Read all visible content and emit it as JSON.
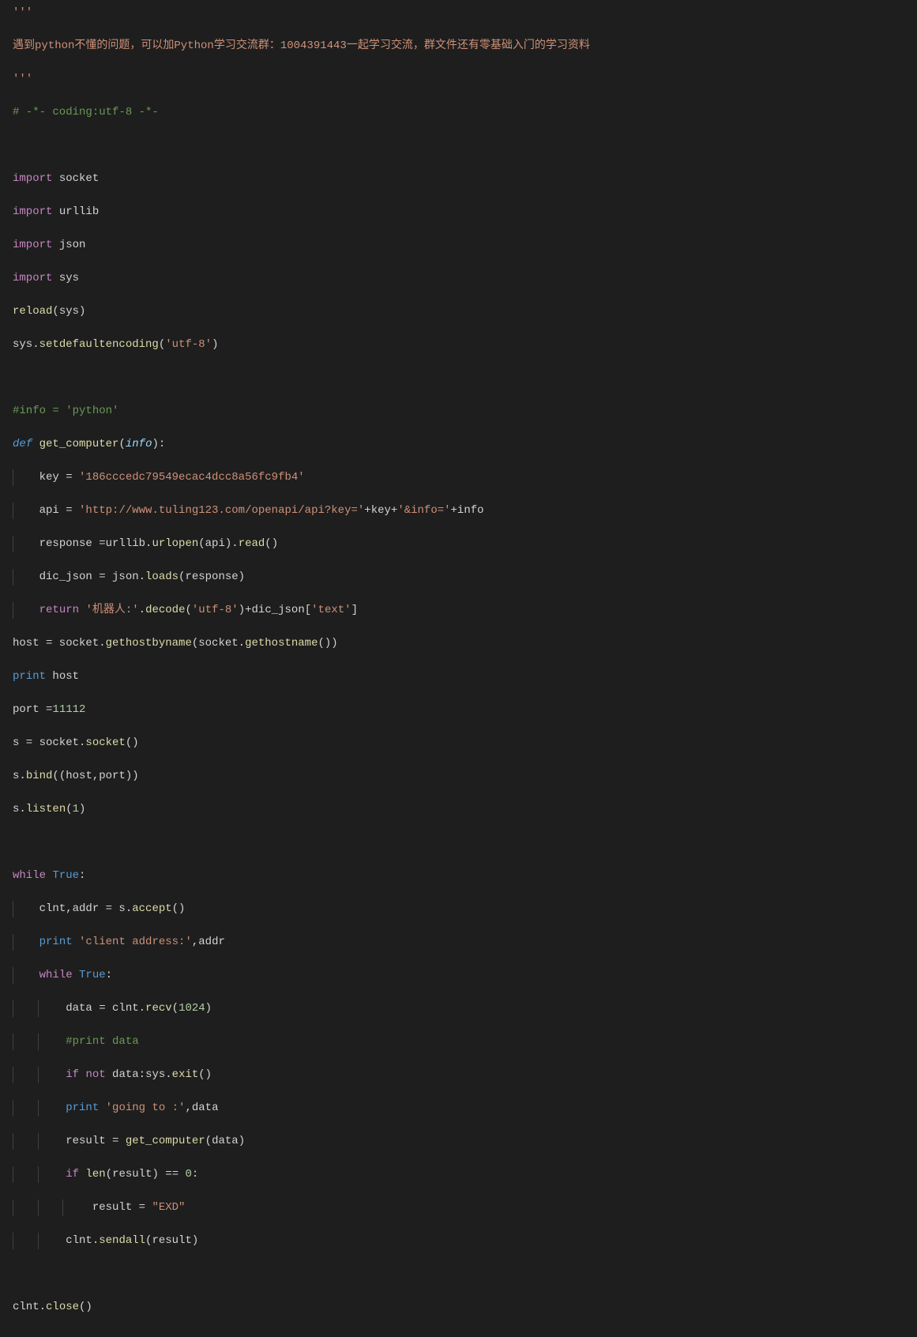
{
  "code": {
    "lines": [
      {
        "indent": 0,
        "tokens": [
          {
            "cls": "tk-string",
            "t": "'''"
          }
        ]
      },
      {
        "indent": 0,
        "tokens": [
          {
            "cls": "tk-string",
            "t": "遇到python不懂的问题，可以加Python学习交流群：1004391443一起学习交流，群文件还有零基础入门的学习资料"
          }
        ]
      },
      {
        "indent": 0,
        "tokens": [
          {
            "cls": "tk-string",
            "t": "'''"
          }
        ]
      },
      {
        "indent": 0,
        "tokens": [
          {
            "cls": "tk-comment",
            "t": "# -*- coding:utf-8 -*-"
          }
        ]
      },
      {
        "indent": 0,
        "tokens": []
      },
      {
        "indent": 0,
        "tokens": [
          {
            "cls": "tk-keyword",
            "t": "import"
          },
          {
            "cls": "tk-default",
            "t": " socket"
          }
        ]
      },
      {
        "indent": 0,
        "tokens": [
          {
            "cls": "tk-keyword",
            "t": "import"
          },
          {
            "cls": "tk-default",
            "t": " urllib"
          }
        ]
      },
      {
        "indent": 0,
        "tokens": [
          {
            "cls": "tk-keyword",
            "t": "import"
          },
          {
            "cls": "tk-default",
            "t": " json"
          }
        ]
      },
      {
        "indent": 0,
        "tokens": [
          {
            "cls": "tk-keyword",
            "t": "import"
          },
          {
            "cls": "tk-default",
            "t": " sys"
          }
        ]
      },
      {
        "indent": 0,
        "tokens": [
          {
            "cls": "tk-funccall",
            "t": "reload"
          },
          {
            "cls": "tk-punct",
            "t": "("
          },
          {
            "cls": "tk-default",
            "t": "sys"
          },
          {
            "cls": "tk-punct",
            "t": ")"
          }
        ]
      },
      {
        "indent": 0,
        "tokens": [
          {
            "cls": "tk-default",
            "t": "sys."
          },
          {
            "cls": "tk-funccall",
            "t": "setdefaultencoding"
          },
          {
            "cls": "tk-punct",
            "t": "("
          },
          {
            "cls": "tk-string",
            "t": "'utf-8'"
          },
          {
            "cls": "tk-punct",
            "t": ")"
          }
        ]
      },
      {
        "indent": 0,
        "tokens": []
      },
      {
        "indent": 0,
        "tokens": [
          {
            "cls": "tk-comment",
            "t": "#info = 'python'"
          }
        ]
      },
      {
        "indent": 0,
        "tokens": [
          {
            "cls": "tk-defkw",
            "t": "def"
          },
          {
            "cls": "tk-default",
            "t": " "
          },
          {
            "cls": "tk-funcname",
            "t": "get_computer"
          },
          {
            "cls": "tk-punct",
            "t": "("
          },
          {
            "cls": "tk-param",
            "t": "info"
          },
          {
            "cls": "tk-punct",
            "t": "):"
          }
        ]
      },
      {
        "indent": 1,
        "tokens": [
          {
            "cls": "tk-default",
            "t": "key = "
          },
          {
            "cls": "tk-string",
            "t": "'186cccedc79549ecac4dcc8a56fc9fb4'"
          }
        ]
      },
      {
        "indent": 1,
        "tokens": [
          {
            "cls": "tk-default",
            "t": "api = "
          },
          {
            "cls": "tk-string",
            "t": "'http://www.tuling123.com/openapi/api?key='"
          },
          {
            "cls": "tk-default",
            "t": "+key+"
          },
          {
            "cls": "tk-string",
            "t": "'&info='"
          },
          {
            "cls": "tk-default",
            "t": "+info"
          }
        ]
      },
      {
        "indent": 1,
        "tokens": [
          {
            "cls": "tk-default",
            "t": "response =urllib."
          },
          {
            "cls": "tk-funccall",
            "t": "urlopen"
          },
          {
            "cls": "tk-punct",
            "t": "("
          },
          {
            "cls": "tk-default",
            "t": "api"
          },
          {
            "cls": "tk-punct",
            "t": ")."
          },
          {
            "cls": "tk-funccall",
            "t": "read"
          },
          {
            "cls": "tk-punct",
            "t": "()"
          }
        ]
      },
      {
        "indent": 1,
        "tokens": [
          {
            "cls": "tk-default",
            "t": "dic_json = json."
          },
          {
            "cls": "tk-funccall",
            "t": "loads"
          },
          {
            "cls": "tk-punct",
            "t": "("
          },
          {
            "cls": "tk-default",
            "t": "response"
          },
          {
            "cls": "tk-punct",
            "t": ")"
          }
        ]
      },
      {
        "indent": 1,
        "tokens": [
          {
            "cls": "tk-keyword",
            "t": "return"
          },
          {
            "cls": "tk-default",
            "t": " "
          },
          {
            "cls": "tk-string",
            "t": "'机器人:'"
          },
          {
            "cls": "tk-punct",
            "t": "."
          },
          {
            "cls": "tk-funccall",
            "t": "decode"
          },
          {
            "cls": "tk-punct",
            "t": "("
          },
          {
            "cls": "tk-string",
            "t": "'utf-8'"
          },
          {
            "cls": "tk-punct",
            "t": ")+"
          },
          {
            "cls": "tk-default",
            "t": "dic_json["
          },
          {
            "cls": "tk-string",
            "t": "'text'"
          },
          {
            "cls": "tk-default",
            "t": "]"
          }
        ]
      },
      {
        "indent": 0,
        "tokens": [
          {
            "cls": "tk-default",
            "t": "host = socket."
          },
          {
            "cls": "tk-funccall",
            "t": "gethostbyname"
          },
          {
            "cls": "tk-punct",
            "t": "("
          },
          {
            "cls": "tk-default",
            "t": "socket."
          },
          {
            "cls": "tk-funccall",
            "t": "gethostname"
          },
          {
            "cls": "tk-punct",
            "t": "())"
          }
        ]
      },
      {
        "indent": 0,
        "tokens": [
          {
            "cls": "tk-const",
            "t": "print"
          },
          {
            "cls": "tk-default",
            "t": " host"
          }
        ]
      },
      {
        "indent": 0,
        "tokens": [
          {
            "cls": "tk-default",
            "t": "port ="
          },
          {
            "cls": "tk-number",
            "t": "11112"
          }
        ]
      },
      {
        "indent": 0,
        "tokens": [
          {
            "cls": "tk-default",
            "t": "s = socket."
          },
          {
            "cls": "tk-funccall",
            "t": "socket"
          },
          {
            "cls": "tk-punct",
            "t": "()"
          }
        ]
      },
      {
        "indent": 0,
        "tokens": [
          {
            "cls": "tk-default",
            "t": "s."
          },
          {
            "cls": "tk-funccall",
            "t": "bind"
          },
          {
            "cls": "tk-punct",
            "t": "(("
          },
          {
            "cls": "tk-default",
            "t": "host,port"
          },
          {
            "cls": "tk-punct",
            "t": "))"
          }
        ]
      },
      {
        "indent": 0,
        "tokens": [
          {
            "cls": "tk-default",
            "t": "s."
          },
          {
            "cls": "tk-funccall",
            "t": "listen"
          },
          {
            "cls": "tk-punct",
            "t": "("
          },
          {
            "cls": "tk-number",
            "t": "1"
          },
          {
            "cls": "tk-punct",
            "t": ")"
          }
        ]
      },
      {
        "indent": 0,
        "tokens": []
      },
      {
        "indent": 0,
        "tokens": [
          {
            "cls": "tk-keyword",
            "t": "while"
          },
          {
            "cls": "tk-default",
            "t": " "
          },
          {
            "cls": "tk-const",
            "t": "True"
          },
          {
            "cls": "tk-punct",
            "t": ":"
          }
        ]
      },
      {
        "indent": 1,
        "tokens": [
          {
            "cls": "tk-default",
            "t": "clnt,addr = s."
          },
          {
            "cls": "tk-funccall",
            "t": "accept"
          },
          {
            "cls": "tk-punct",
            "t": "()"
          }
        ]
      },
      {
        "indent": 1,
        "tokens": [
          {
            "cls": "tk-const",
            "t": "print"
          },
          {
            "cls": "tk-default",
            "t": " "
          },
          {
            "cls": "tk-string",
            "t": "'client address:'"
          },
          {
            "cls": "tk-default",
            "t": ",addr"
          }
        ]
      },
      {
        "indent": 1,
        "tokens": [
          {
            "cls": "tk-keyword",
            "t": "while"
          },
          {
            "cls": "tk-default",
            "t": " "
          },
          {
            "cls": "tk-const",
            "t": "True"
          },
          {
            "cls": "tk-punct",
            "t": ":"
          }
        ]
      },
      {
        "indent": 2,
        "tokens": [
          {
            "cls": "tk-default",
            "t": "data = clnt."
          },
          {
            "cls": "tk-funccall",
            "t": "recv"
          },
          {
            "cls": "tk-punct",
            "t": "("
          },
          {
            "cls": "tk-number",
            "t": "1024"
          },
          {
            "cls": "tk-punct",
            "t": ")"
          }
        ]
      },
      {
        "indent": 2,
        "tokens": [
          {
            "cls": "tk-comment",
            "t": "#print data"
          }
        ]
      },
      {
        "indent": 2,
        "tokens": [
          {
            "cls": "tk-keyword",
            "t": "if"
          },
          {
            "cls": "tk-default",
            "t": " "
          },
          {
            "cls": "tk-keyword",
            "t": "not"
          },
          {
            "cls": "tk-default",
            "t": " data:sys."
          },
          {
            "cls": "tk-funccall",
            "t": "exit"
          },
          {
            "cls": "tk-punct",
            "t": "()"
          }
        ]
      },
      {
        "indent": 2,
        "tokens": [
          {
            "cls": "tk-const",
            "t": "print"
          },
          {
            "cls": "tk-default",
            "t": " "
          },
          {
            "cls": "tk-string",
            "t": "'going to :'"
          },
          {
            "cls": "tk-default",
            "t": ",data"
          }
        ]
      },
      {
        "indent": 2,
        "tokens": [
          {
            "cls": "tk-default",
            "t": "result = "
          },
          {
            "cls": "tk-funccall",
            "t": "get_computer"
          },
          {
            "cls": "tk-punct",
            "t": "("
          },
          {
            "cls": "tk-default",
            "t": "data"
          },
          {
            "cls": "tk-punct",
            "t": ")"
          }
        ]
      },
      {
        "indent": 2,
        "tokens": [
          {
            "cls": "tk-keyword",
            "t": "if"
          },
          {
            "cls": "tk-default",
            "t": " "
          },
          {
            "cls": "tk-funccall",
            "t": "len"
          },
          {
            "cls": "tk-punct",
            "t": "("
          },
          {
            "cls": "tk-default",
            "t": "result"
          },
          {
            "cls": "tk-punct",
            "t": ") == "
          },
          {
            "cls": "tk-number",
            "t": "0"
          },
          {
            "cls": "tk-punct",
            "t": ":"
          }
        ]
      },
      {
        "indent": 3,
        "tokens": [
          {
            "cls": "tk-default",
            "t": "result = "
          },
          {
            "cls": "tk-string",
            "t": "\"EXD\""
          }
        ]
      },
      {
        "indent": 2,
        "tokens": [
          {
            "cls": "tk-default",
            "t": "clnt."
          },
          {
            "cls": "tk-funccall",
            "t": "sendall"
          },
          {
            "cls": "tk-punct",
            "t": "("
          },
          {
            "cls": "tk-default",
            "t": "result"
          },
          {
            "cls": "tk-punct",
            "t": ")"
          }
        ]
      },
      {
        "indent": 0,
        "tokens": []
      },
      {
        "indent": 0,
        "tokens": [
          {
            "cls": "tk-default",
            "t": "clnt."
          },
          {
            "cls": "tk-funccall",
            "t": "close"
          },
          {
            "cls": "tk-punct",
            "t": "()"
          }
        ]
      }
    ]
  }
}
